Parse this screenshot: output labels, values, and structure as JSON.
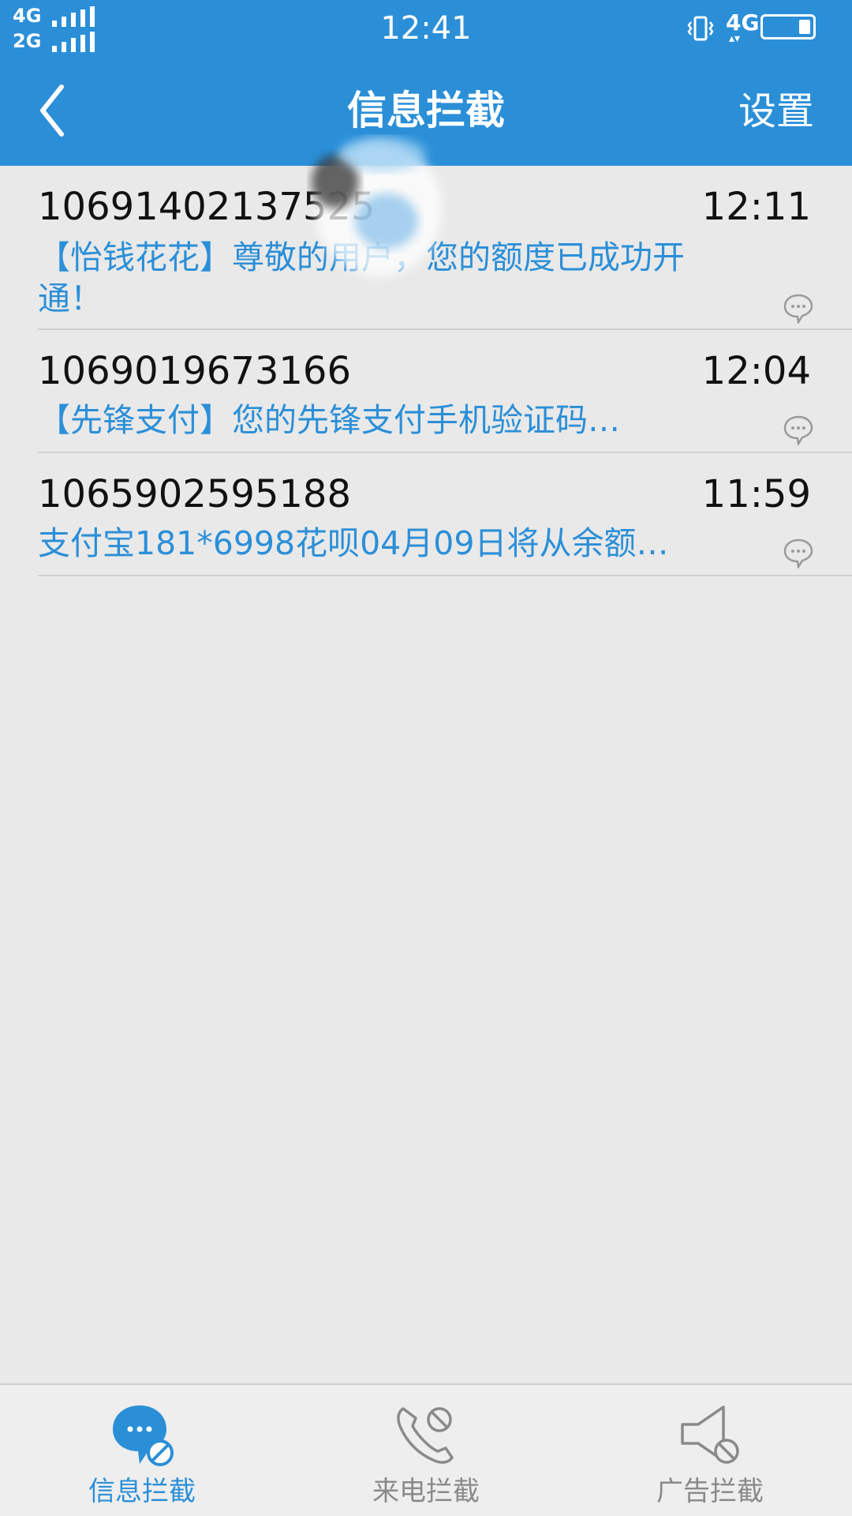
{
  "status_bar": {
    "sim1": "4G",
    "sim2": "2G",
    "time": "12:41",
    "network": "4G"
  },
  "header": {
    "back_label": "<",
    "title": "信息拦截",
    "settings_label": "设置"
  },
  "messages": [
    {
      "sender": "10691402137525",
      "time": "12:11",
      "preview": "【怡钱花花】尊敬的用户，您的额度已成功开通！"
    },
    {
      "sender": "1069019673166",
      "time": "12:04",
      "preview": "【先锋支付】您的先锋支付手机验证码…"
    },
    {
      "sender": "1065902595188",
      "time": "11:59",
      "preview": "支付宝181*6998花呗04月09日将从余额…"
    }
  ],
  "tabs": [
    {
      "label": "信息拦截",
      "icon": "message-block-icon",
      "active": true
    },
    {
      "label": "来电拦截",
      "icon": "call-block-icon",
      "active": false
    },
    {
      "label": "广告拦截",
      "icon": "ad-block-icon",
      "active": false
    }
  ],
  "colors": {
    "accent": "#2b8fd8",
    "background": "#e9e9e9",
    "text": "#111111",
    "inactive": "#8a8a8a"
  }
}
